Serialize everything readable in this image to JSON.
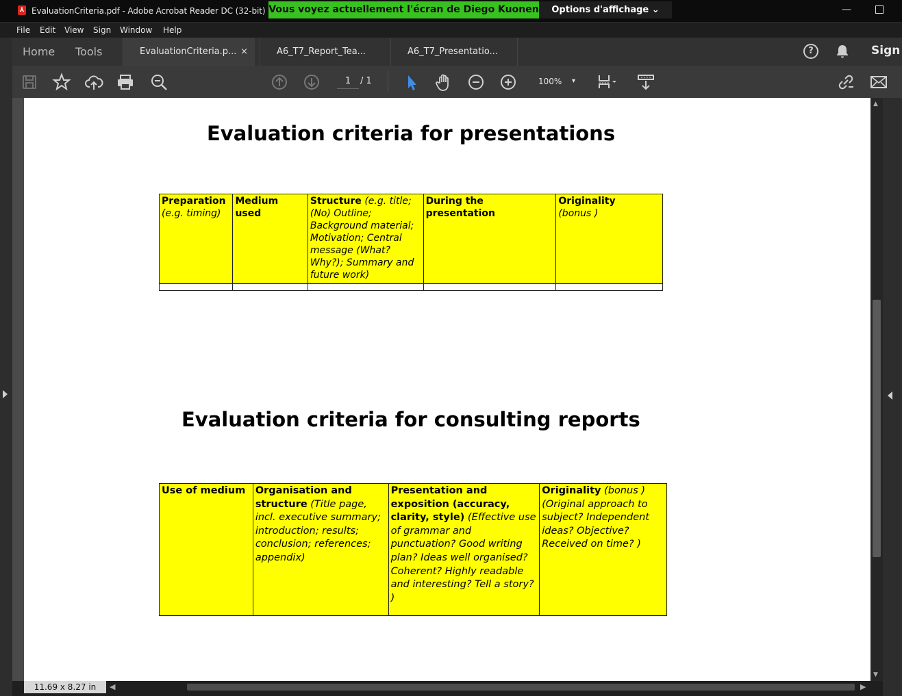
{
  "window": {
    "title": "EvaluationCriteria.pdf - Adobe Acrobat Reader DC (32-bit)",
    "share_banner": "Vous voyez actuellement l'écran de Diego Kuonen",
    "options_label": "Options d'affichage ⌄",
    "minimize": "—"
  },
  "menu": [
    "File",
    "Edit",
    "View",
    "Sign",
    "Window",
    "Help"
  ],
  "tabs": {
    "home": "Home",
    "tools": "Tools",
    "docs": [
      {
        "label": "EvaluationCriteria.p...",
        "close": "×"
      },
      {
        "label": "A6_T7_Report_Tea..."
      },
      {
        "label": "A6_T7_Presentatio..."
      }
    ],
    "help": "?",
    "sign_in": "Sign"
  },
  "toolbar": {
    "page_current": "1",
    "page_total": "/ 1",
    "zoom": "100%",
    "zoom_caret": "▾"
  },
  "status": {
    "page_size": "11.69 x 8.27 in"
  },
  "document": {
    "title1": "Evaluation criteria for presentations",
    "table1": [
      {
        "bold": "Preparation",
        "italic": "(e.g. timing)"
      },
      {
        "bold": "Medium used",
        "italic": ""
      },
      {
        "bold": "Structure",
        "italic": " (e.g. title; (No) Outline; Background material; Motivation; Central message (What? Why?); Summary and future work)"
      },
      {
        "bold": "During the presentation",
        "italic": ""
      },
      {
        "bold": "Originality",
        "italic": "(bonus )"
      }
    ],
    "title2": "Evaluation criteria for consulting reports",
    "table2": [
      {
        "bold": "Use of medium",
        "italic": ""
      },
      {
        "bold": "Organisation and structure",
        "italic": " (Title page, incl. executive summary; introduction; results; conclusion; references; appendix)"
      },
      {
        "bold": "Presentation and exposition (accuracy, clarity, style)",
        "italic": " (Effective use of grammar and punctuation? Good writing plan? Ideas well organised? Coherent? Highly readable and interesting? Tell a story? )"
      },
      {
        "bold": "Originality",
        "italic": " (bonus ) (Original approach to subject? Independent ideas? Objective? Received on time? )"
      }
    ]
  }
}
